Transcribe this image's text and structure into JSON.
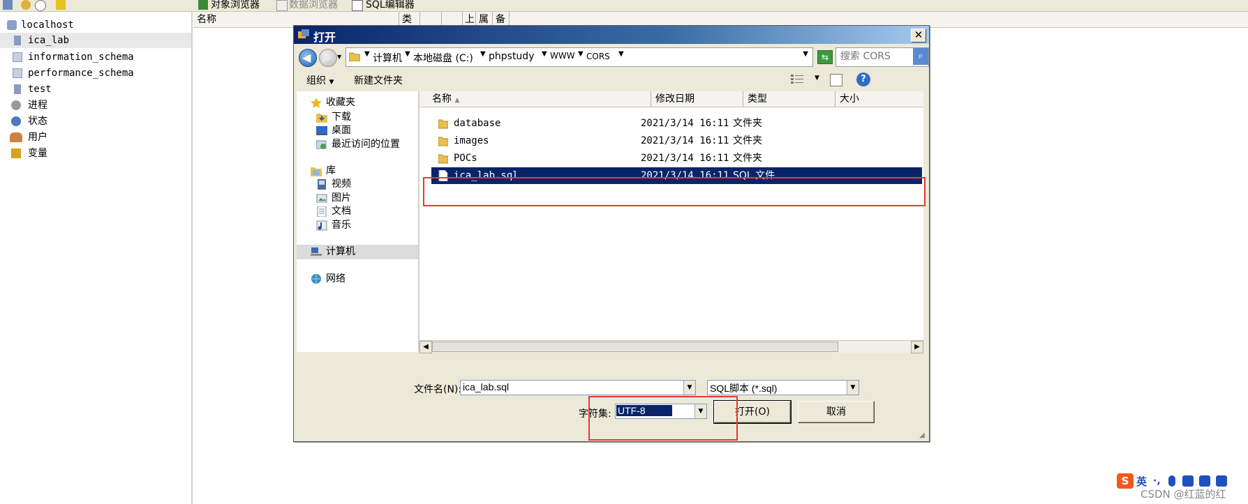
{
  "app": {
    "toolbar_tabs": [
      {
        "label": "对象浏览器",
        "active": true
      },
      {
        "label": "数据浏览器",
        "active": false
      },
      {
        "label": "SQL编辑器",
        "active": false
      }
    ],
    "tree": [
      {
        "label": "localhost",
        "icon": "server-icon"
      },
      {
        "label": "ica_lab",
        "icon": "database-icon",
        "selected": true
      },
      {
        "label": "information_schema",
        "icon": "database-icon"
      },
      {
        "label": "performance_schema",
        "icon": "database-icon"
      },
      {
        "label": "test",
        "icon": "database-icon"
      },
      {
        "label": "进程",
        "icon": "process-icon"
      },
      {
        "label": "状态",
        "icon": "status-icon"
      },
      {
        "label": "用户",
        "icon": "users-icon"
      },
      {
        "label": "变量",
        "icon": "variable-icon"
      }
    ],
    "header_col": "名称",
    "header_cols_clipped": [
      "类",
      "上",
      "属",
      "备"
    ]
  },
  "dialog": {
    "title": "打开",
    "close": "✕",
    "breadcrumbs": [
      "计算机",
      "本地磁盘 (C:)",
      "phpstudy",
      "WWW",
      "CORS"
    ],
    "search_placeholder": "搜索 CORS",
    "commands": {
      "organize": "组织",
      "new_folder": "新建文件夹"
    },
    "nav": {
      "favorites": "收藏夹",
      "favorite_items": [
        "下载",
        "桌面",
        "最近访问的位置"
      ],
      "libraries": "库",
      "library_items": [
        "视频",
        "图片",
        "文档",
        "音乐"
      ],
      "computer": "计算机",
      "network": "网络"
    },
    "columns": [
      "名称",
      "修改日期",
      "类型",
      "大小"
    ],
    "files": [
      {
        "name": "database",
        "date": "2021/3/14 16:11",
        "type": "文件夹",
        "kind": "folder"
      },
      {
        "name": "images",
        "date": "2021/3/14 16:11",
        "type": "文件夹",
        "kind": "folder"
      },
      {
        "name": "POCs",
        "date": "2021/3/14 16:11",
        "type": "文件夹",
        "kind": "folder"
      },
      {
        "name": "ica_lab.sql",
        "date": "2021/3/14 16:11",
        "type": "SQL 文件",
        "kind": "file",
        "selected": true
      }
    ],
    "filename_label": "文件名(N):",
    "filename_value": "ica_lab.sql",
    "filetype_value": "SQL脚本 (*.sql)",
    "charset_label": "字符集:",
    "charset_value": "UTF-8",
    "open_label": "打开(O)",
    "cancel_label": "取消"
  },
  "ime": {
    "lang": "英"
  },
  "watermark": "CSDN @红蓝的红",
  "colors": {
    "selection": "#0a246a",
    "highlight": "#e53935",
    "title_start": "#0a246a",
    "title_end": "#a6caf0"
  }
}
